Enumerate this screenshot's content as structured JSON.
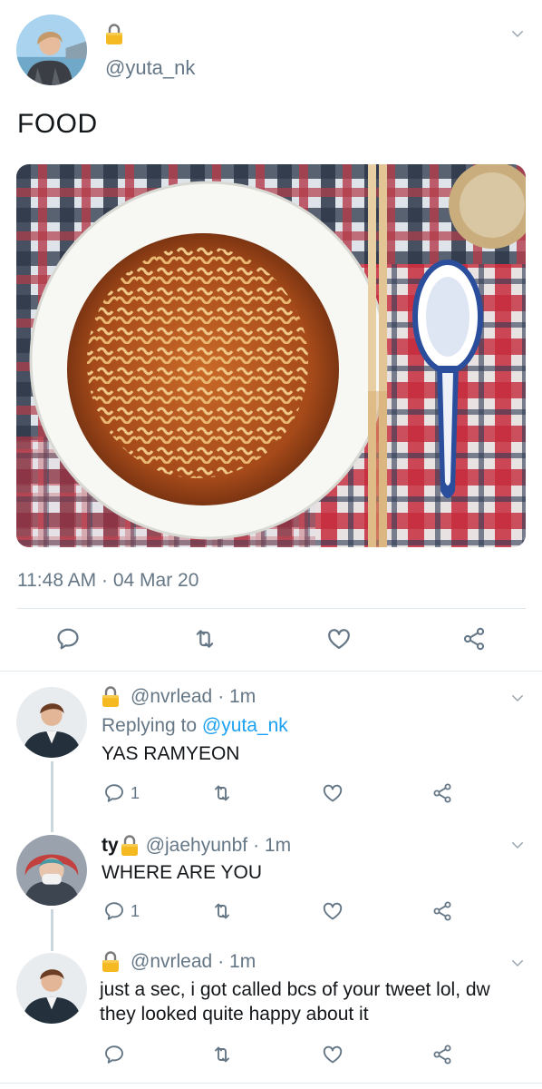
{
  "tweet": {
    "username": "@yuta_nk",
    "text": "FOOD",
    "time": "11:48 AM",
    "sep": "·",
    "date": "04 Mar 20"
  },
  "replies": [
    {
      "display_name": "",
      "username": "@nvrlead",
      "time": "· 1m",
      "replying_prefix": "Replying to",
      "replying_to": "@yuta_nk",
      "text": "YAS RAMYEON",
      "reply_count": "1"
    },
    {
      "display_name": "ty",
      "username": "@jaehyunbf",
      "time": "· 1m",
      "text": "WHERE ARE YOU",
      "reply_count": "1"
    },
    {
      "display_name": "",
      "username": "@nvrlead",
      "time": "· 1m",
      "text": "just a sec, i got called bcs of your tweet lol, dw they looked quite happy about it",
      "reply_count": ""
    }
  ],
  "icons": {
    "lock": "lock-icon",
    "chevron": "chevron-down-icon",
    "reply": "reply-icon",
    "retweet": "retweet-icon",
    "like": "heart-icon",
    "share": "share-icon"
  },
  "colors": {
    "lock": "#f5b922",
    "link": "#1da1f2",
    "secondary_text": "#657786",
    "icon": "#657786"
  }
}
